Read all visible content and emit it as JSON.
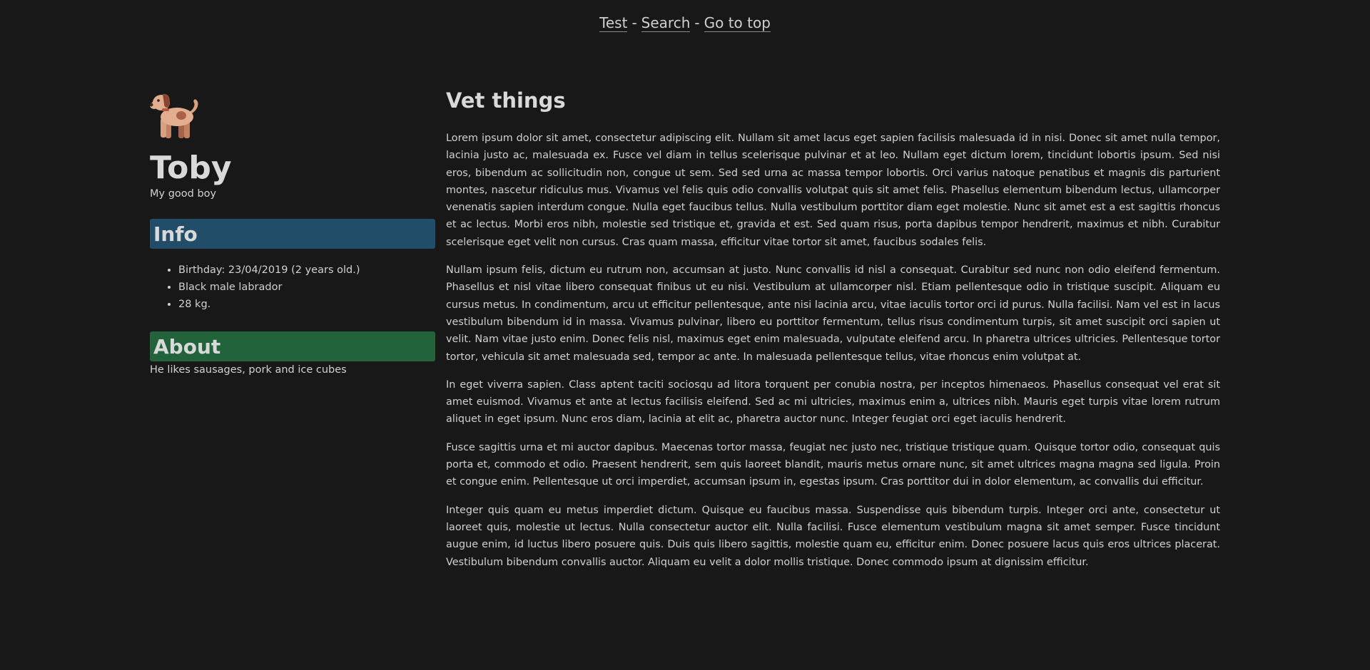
{
  "nav": {
    "links": [
      "Test",
      "Search",
      "Go to top"
    ],
    "separator": "-"
  },
  "pet": {
    "avatar_icon": "dog-icon",
    "name": "Toby",
    "tagline": "My good boy"
  },
  "info": {
    "title": "Info",
    "color": "#224d68",
    "items": [
      "Birthday: 23/04/2019 (2 years old.)",
      "Black male labrador",
      "28 kg."
    ]
  },
  "about": {
    "title": "About",
    "color": "#23633c",
    "text": "He likes sausages, pork and ice cubes"
  },
  "main": {
    "title": "Vet things",
    "paragraphs": [
      "Lorem ipsum dolor sit amet, consectetur adipiscing elit. Nullam sit amet lacus eget sapien facilisis malesuada id in nisi. Donec sit amet nulla tempor, lacinia justo ac, malesuada ex. Fusce vel diam in tellus scelerisque pulvinar et at leo. Nullam eget dictum lorem, tincidunt lobortis ipsum. Sed nisi eros, bibendum ac sollicitudin non, congue ut sem. Sed sed urna ac massa tempor lobortis. Orci varius natoque penatibus et magnis dis parturient montes, nascetur ridiculus mus. Vivamus vel felis quis odio convallis volutpat quis sit amet felis. Phasellus elementum bibendum lectus, ullamcorper venenatis sapien interdum congue. Nulla eget faucibus tellus. Nulla vestibulum porttitor diam eget molestie. Nunc sit amet est a est sagittis rhoncus et ac lectus. Morbi eros nibh, molestie sed tristique et, gravida et est. Sed quam risus, porta dapibus tempor hendrerit, maximus et nibh. Curabitur scelerisque eget velit non cursus. Cras quam massa, efficitur vitae tortor sit amet, faucibus sodales felis.",
      "Nullam ipsum felis, dictum eu rutrum non, accumsan at justo. Nunc convallis id nisl a consequat. Curabitur sed nunc non odio eleifend fermentum. Phasellus et nisl vitae libero consequat finibus ut eu nisi. Vestibulum at ullamcorper nisl. Etiam pellentesque odio in tristique suscipit. Aliquam eu cursus metus. In condimentum, arcu ut efficitur pellentesque, ante nisi lacinia arcu, vitae iaculis tortor orci id purus. Nulla facilisi. Nam vel est in lacus vestibulum bibendum id in massa. Vivamus pulvinar, libero eu porttitor fermentum, tellus risus condimentum turpis, sit amet suscipit orci sapien ut velit. Nam vitae justo enim. Donec felis nisl, maximus eget enim malesuada, vulputate eleifend arcu. In pharetra ultrices ultricies. Pellentesque tortor tortor, vehicula sit amet malesuada sed, tempor ac ante. In malesuada pellentesque tellus, vitae rhoncus enim volutpat at.",
      "In eget viverra sapien. Class aptent taciti sociosqu ad litora torquent per conubia nostra, per inceptos himenaeos. Phasellus consequat vel erat sit amet euismod. Vivamus et ante at lectus facilisis eleifend. Sed ac mi ultricies, maximus enim a, ultrices nibh. Mauris eget turpis vitae lorem rutrum aliquet in eget ipsum. Nunc eros diam, lacinia at elit ac, pharetra auctor nunc. Integer feugiat orci eget iaculis hendrerit.",
      "Fusce sagittis urna et mi auctor dapibus. Maecenas tortor massa, feugiat nec justo nec, tristique tristique quam. Quisque tortor odio, consequat quis porta et, commodo et odio. Praesent hendrerit, sem quis laoreet blandit, mauris metus ornare nunc, sit amet ultrices magna magna sed ligula. Proin et congue enim. Pellentesque ut orci imperdiet, accumsan ipsum in, egestas ipsum. Cras porttitor dui in dolor elementum, ac convallis dui efficitur.",
      "Integer quis quam eu metus imperdiet dictum. Quisque eu faucibus massa. Suspendisse quis bibendum turpis. Integer orci ante, consectetur ut laoreet quis, molestie ut lectus. Nulla consectetur auctor elit. Nulla facilisi. Fusce elementum vestibulum magna sit amet semper. Fusce tincidunt augue enim, id luctus libero posuere quis. Duis quis libero sagittis, molestie quam eu, efficitur enim. Donec posuere lacus quis eros ultrices placerat. Vestibulum bibendum convallis auctor. Aliquam eu velit a dolor mollis tristique. Donec commodo ipsum at dignissim efficitur."
    ]
  }
}
